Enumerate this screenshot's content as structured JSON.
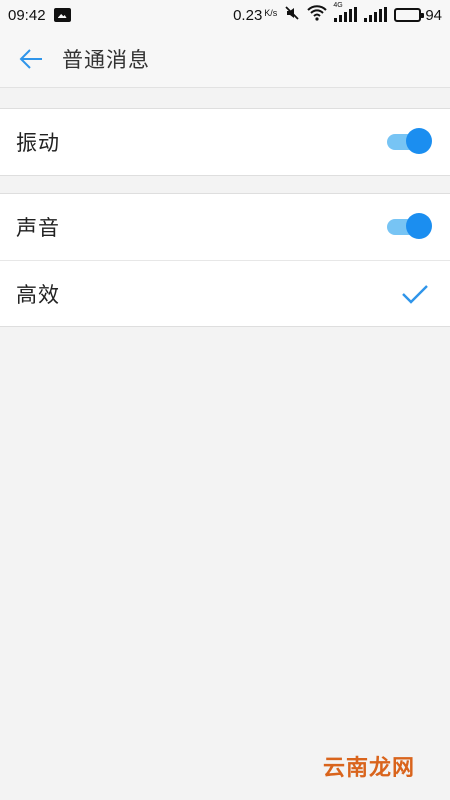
{
  "status_bar": {
    "time": "09:42",
    "net_speed": "0.23",
    "net_speed_unit": "K/s",
    "network_label": "4G",
    "battery_level": "94",
    "battery_fraction": 0.94,
    "icons": [
      "gallery-icon",
      "mute-icon",
      "wifi-icon",
      "signal-icon",
      "signal-icon",
      "battery-icon"
    ]
  },
  "app_bar": {
    "back_icon": "arrow-left-icon",
    "title": "普通消息"
  },
  "settings": {
    "vibration": {
      "label": "振动",
      "enabled": true
    },
    "sound": {
      "label": "声音",
      "enabled": true
    },
    "efficient": {
      "label": "高效",
      "selected": true
    }
  },
  "watermark": "云南龙网",
  "colors": {
    "accent": "#1b8ef0",
    "track": "#77c4f4",
    "background": "#f3f3f3",
    "surface": "#ffffff",
    "watermark": "#d9641c"
  }
}
